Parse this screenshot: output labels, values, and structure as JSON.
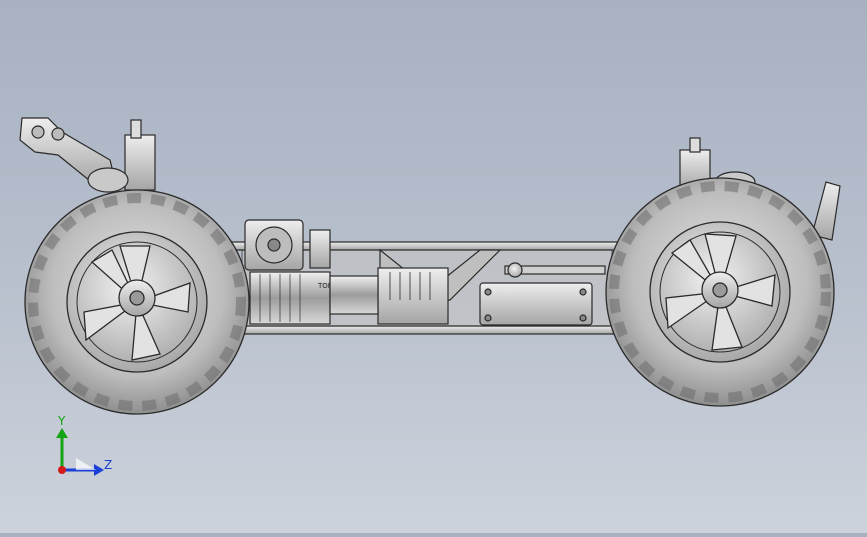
{
  "viewport": {
    "model_name": "",
    "motor_label": "TOR"
  },
  "triad": {
    "y_label": "Y",
    "z_label": "Z",
    "y_color": "#16a316",
    "z_color": "#1a3fd6",
    "x_color": "#d61a1a"
  },
  "colors": {
    "background_top": "#a7b1c1",
    "background_bottom": "#cdd3dc",
    "tire": "#c8c8c8",
    "metal": "#d7d7d7",
    "outline": "#2a2a2a"
  }
}
